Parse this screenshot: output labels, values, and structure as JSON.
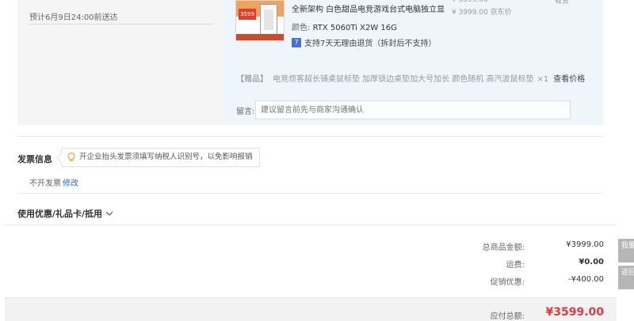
{
  "delivery": {
    "note": "预计6月9日24:00前送达"
  },
  "product": {
    "name": "全新架构 白色甜品电竞游戏台式电脑独立显",
    "spec_label": "颜色:",
    "spec_value": "RTX 5060Ti X2W 16G",
    "return_icon": "7",
    "return_policy": "支持7天无理由退货（拆封后不支持）",
    "price_original": "¥ 3999.00 京东价",
    "thumb_badge": "3599"
  },
  "gift": {
    "tag": "【赠品】",
    "text": "电竞烦客超长铺桌鼠标垫 加厚锁边桌垫加大号加长 颜色随机 高汽波鼠标垫",
    "qty": "×1",
    "link": "查看价格"
  },
  "remark": {
    "label": "留言:",
    "placeholder": "建议留言前先与商家沟通确认"
  },
  "invoice": {
    "title": "发票信息",
    "tip": "开企业抬头发票须填写纳税人识别号，以免影响报销",
    "value": "不开发票",
    "edit": "修改"
  },
  "coupon": {
    "title": "使用优惠/礼品卡/抵用"
  },
  "summary": {
    "goods_label": "总商品金额:",
    "goods_value": "¥3999.00",
    "freight_label": "运费:",
    "freight_value": "¥0.00",
    "discount_label": "促销优惠:",
    "discount_value": "-¥400.00",
    "total_label": "应付总额:",
    "total_value": "¥3599.00"
  },
  "side": {
    "feedback": "我要反馈",
    "back_top": "返回顶部"
  },
  "colors": {
    "accent_red": "#e4393c",
    "link_blue": "#2a6bbf",
    "product_bg": "#eef6fc"
  }
}
